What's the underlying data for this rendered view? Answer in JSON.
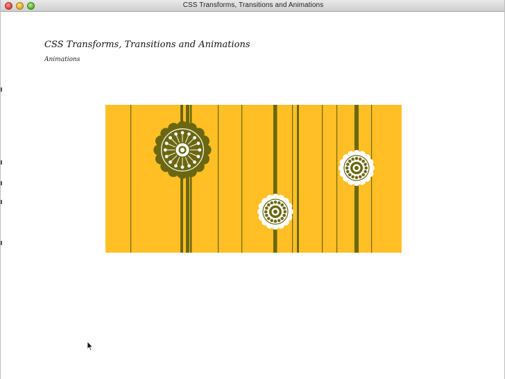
{
  "window": {
    "title": "CSS Transforms, Transitions and Animations"
  },
  "page": {
    "heading": "CSS Transforms, Transitions and Animations",
    "subheading": "Animations"
  },
  "animation": {
    "background_color": "#ffbf25",
    "stripe_color": "#6b6710",
    "flower_color": "#6b6710",
    "flower_fill": "#ffffff"
  },
  "icons": {
    "close": "close-icon",
    "minimize": "minimize-icon",
    "maximize": "maximize-icon",
    "cursor": "mouse-pointer-icon"
  }
}
